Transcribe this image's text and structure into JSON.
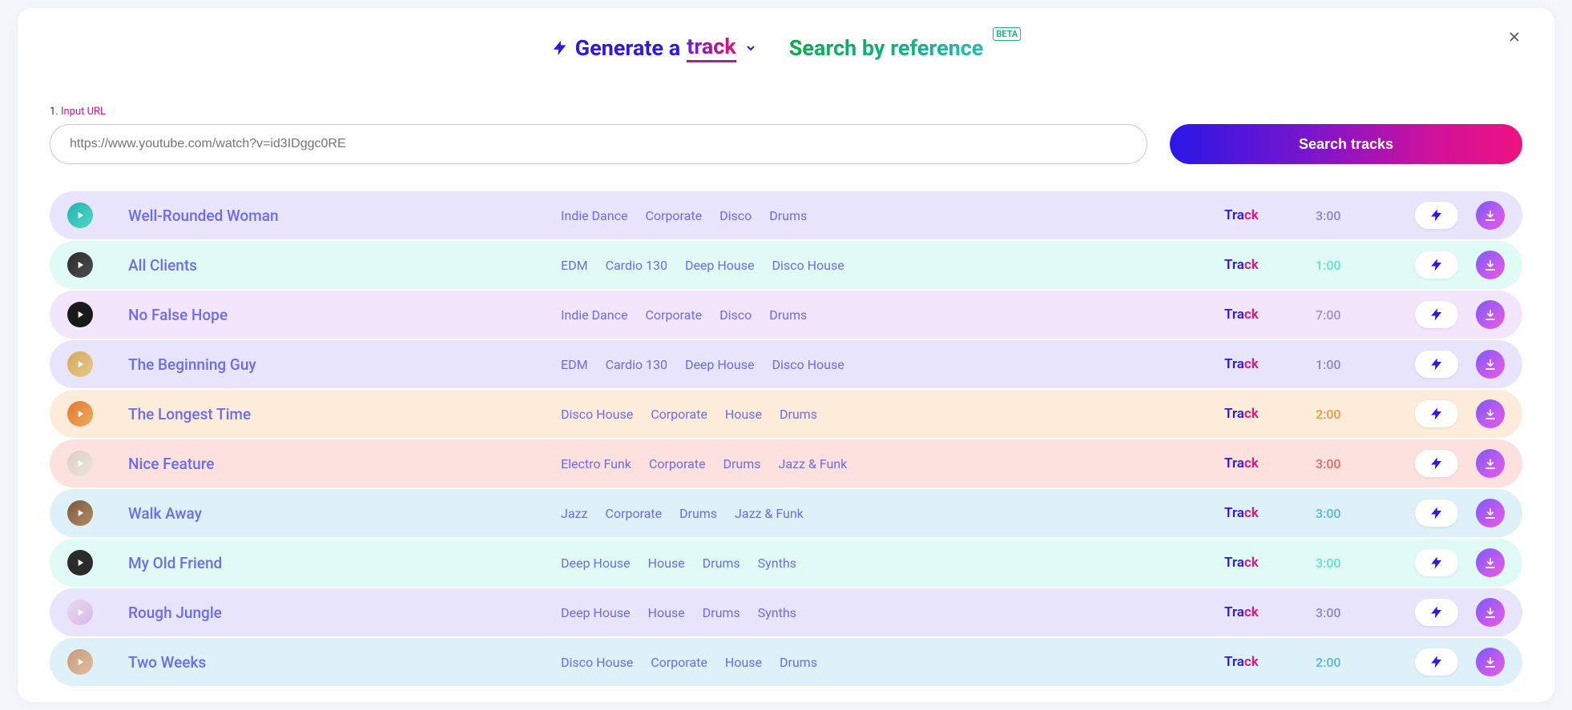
{
  "tabs": {
    "generate_prefix": "Generate a ",
    "generate_word": "track",
    "search": "Search by reference",
    "beta": "BETA"
  },
  "input": {
    "label_num": "1.",
    "label_text": " Input URL",
    "placeholder": "https://www.youtube.com/watch?v=id3IDggc0RE"
  },
  "search_button": "Search tracks",
  "type_label_parts": {
    "tra": "Tra",
    "ck": "ck"
  },
  "tracks": [
    {
      "title": "Well-Rounded Woman",
      "tags": [
        "Indie Dance",
        "Corporate",
        "Disco",
        "Drums"
      ],
      "duration": "3:00",
      "row_bg": "#e7e4fb",
      "duration_color": "#8a87c9",
      "thumb_bg": "linear-gradient(135deg,#1fb3b3,#55d6c2)"
    },
    {
      "title": "All Clients",
      "tags": [
        "EDM",
        "Cardio 130",
        "Deep House",
        "Disco House"
      ],
      "duration": "1:00",
      "row_bg": "#e0fbf6",
      "duration_color": "#63e0cf",
      "thumb_bg": "linear-gradient(135deg,#2b2b2b,#4e4e4e)"
    },
    {
      "title": "No False Hope",
      "tags": [
        "Indie Dance",
        "Corporate",
        "Disco",
        "Drums"
      ],
      "duration": "7:00",
      "row_bg": "#f3e5fb",
      "duration_color": "#a58bd8",
      "thumb_bg": "#1a1a1a"
    },
    {
      "title": "The Beginning Guy",
      "tags": [
        "EDM",
        "Cardio 130",
        "Deep House",
        "Disco House"
      ],
      "duration": "1:00",
      "row_bg": "#e7e4fb",
      "duration_color": "#8a87c9",
      "thumb_bg": "linear-gradient(135deg,#d6a85a,#e6c98a)"
    },
    {
      "title": "The Longest Time",
      "tags": [
        "Disco House",
        "Corporate",
        "House",
        "Drums"
      ],
      "duration": "2:00",
      "row_bg": "#fdecd9",
      "duration_color": "#e79a4d",
      "thumb_bg": "linear-gradient(135deg,#e07b2f,#f0a95e)"
    },
    {
      "title": "Nice Feature",
      "tags": [
        "Electro Funk",
        "Corporate",
        "Drums",
        "Jazz & Funk"
      ],
      "duration": "3:00",
      "row_bg": "#fce1df",
      "duration_color": "#e06a5f",
      "thumb_bg": "linear-gradient(135deg,#d9d0c6,#ece6df)"
    },
    {
      "title": "Walk Away",
      "tags": [
        "Jazz",
        "Corporate",
        "Drums",
        "Jazz & Funk"
      ],
      "duration": "3:00",
      "row_bg": "#def0f8",
      "duration_color": "#5ab6d1",
      "thumb_bg": "linear-gradient(135deg,#7a5a3d,#b18a64)"
    },
    {
      "title": "My Old Friend",
      "tags": [
        "Deep House",
        "House",
        "Drums",
        "Synths"
      ],
      "duration": "3:00",
      "row_bg": "#e0fbf6",
      "duration_color": "#63e0cf",
      "thumb_bg": "#2b2b2b"
    },
    {
      "title": "Rough Jungle",
      "tags": [
        "Deep House",
        "House",
        "Drums",
        "Synths"
      ],
      "duration": "3:00",
      "row_bg": "#e7e4fb",
      "duration_color": "#8a87c9",
      "thumb_bg": "linear-gradient(135deg,#e7d7f0,#d9b9ea)"
    },
    {
      "title": "Two Weeks",
      "tags": [
        "Disco House",
        "Corporate",
        "House",
        "Drums"
      ],
      "duration": "2:00",
      "row_bg": "#def0f8",
      "duration_color": "#5ab6d1",
      "thumb_bg": "linear-gradient(135deg,#c79a7a,#e0bda1)"
    }
  ]
}
